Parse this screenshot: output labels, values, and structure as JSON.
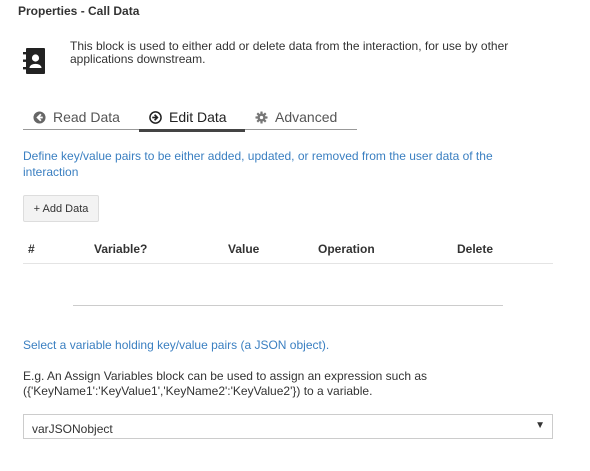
{
  "header": {
    "title": "Properties - Call Data"
  },
  "info": {
    "icon": "contact-book-icon",
    "description": "This block is used to either add or delete data from the interaction, for use by other applications downstream."
  },
  "tabs": [
    {
      "label": "Read Data",
      "icon": "arrow-left-circle-icon",
      "active": false
    },
    {
      "label": "Edit Data",
      "icon": "arrow-right-circle-icon",
      "active": true
    },
    {
      "label": "Advanced",
      "icon": "gear-icon",
      "active": false
    }
  ],
  "edit": {
    "instructions": "Define key/value pairs to be either added, updated, or removed from the user data of the interaction",
    "add_button": "+ Add Data",
    "columns": [
      "#",
      "Variable?",
      "Value",
      "Operation",
      "Delete"
    ]
  },
  "json_section": {
    "label": "Select a variable holding key/value pairs (a JSON object).",
    "example": "E.g. An Assign Variables block can be used to assign an expression such as ({'KeyName1':'KeyValue1','KeyName2':'KeyValue2'}) to a variable.",
    "selected_value": "varJSONobject"
  },
  "colors": {
    "link_blue": "#3a7fc1",
    "text": "#333333",
    "border": "#cccccc"
  }
}
